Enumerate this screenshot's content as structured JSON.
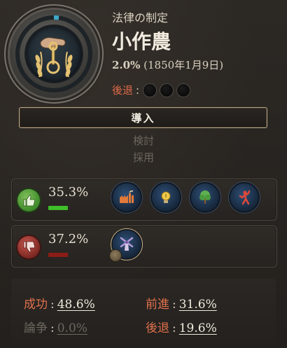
{
  "header": {
    "category": "法律の制定",
    "law_name": "小作農",
    "support_pct": "2.0%",
    "date": "(1850年1月9日)",
    "backsliding_label": "後退",
    "backsliding_slots": 3
  },
  "actions": {
    "enact_label": "導入",
    "options": [
      "検討",
      "採用"
    ]
  },
  "supporters": {
    "pct": "35.3%",
    "bar_color": "#3fbf2a",
    "groups": [
      {
        "icon": "industrialists-icon"
      },
      {
        "icon": "intelligentsia-icon"
      },
      {
        "icon": "rural-folk-icon"
      },
      {
        "icon": "trade-unions-icon"
      }
    ]
  },
  "opponents": {
    "pct": "37.2%",
    "bar_color": "#8c1c16",
    "groups": [
      {
        "icon": "landowners-icon"
      }
    ]
  },
  "stats": {
    "success_label": "成功",
    "success_value": "48.6%",
    "advance_label": "前進",
    "advance_value": "31.6%",
    "debate_label": "論争",
    "debate_value": "0.0%",
    "backslide_label": "後退",
    "backslide_value": "19.6%"
  },
  "colors": {
    "accent_red": "#e0714c",
    "button_border": "#b9a682",
    "icon_bg": "#2f4f76"
  }
}
